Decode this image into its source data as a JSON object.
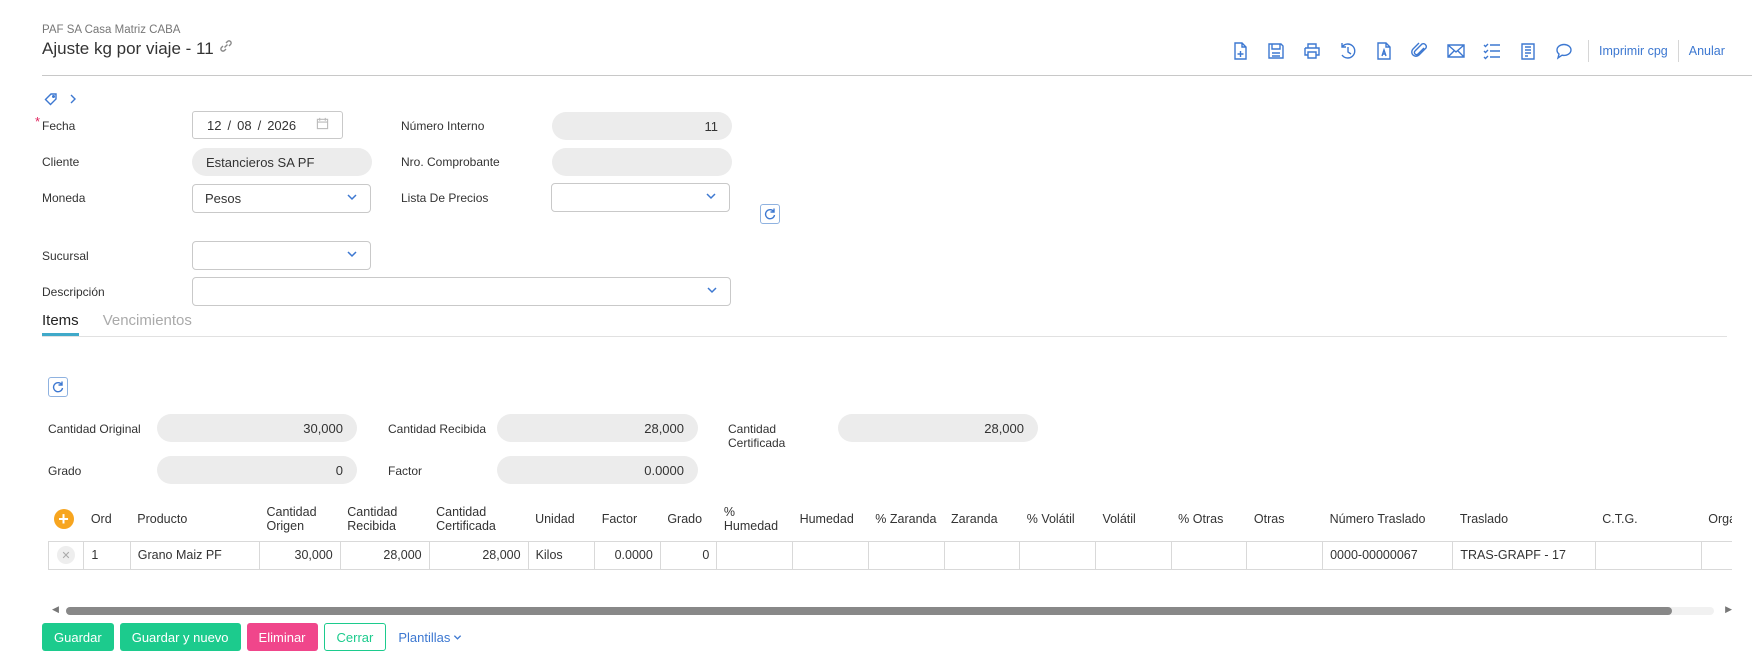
{
  "header": {
    "company": "PAF SA Casa Matriz CABA",
    "title": "Ajuste kg por viaje - 11"
  },
  "toolbar": {
    "icons": [
      "new-doc-icon",
      "save-icon",
      "print-icon",
      "history-icon",
      "pdf-icon",
      "attach-icon",
      "email-icon",
      "checklist-icon",
      "report-icon",
      "comment-icon"
    ],
    "print_cpg": "Imprimir cpg",
    "anular": "Anular"
  },
  "form": {
    "fecha_label": "Fecha",
    "fecha_day": "12",
    "fecha_month": "08",
    "fecha_year": "2026",
    "numero_interno_label": "Número Interno",
    "numero_interno": "11",
    "cliente_label": "Cliente",
    "cliente": "Estancieros SA PF",
    "nro_comprobante_label": "Nro. Comprobante",
    "nro_comprobante": "",
    "moneda_label": "Moneda",
    "moneda": "Pesos",
    "lista_precios_label": "Lista De Precios",
    "lista_precios": "",
    "sucursal_label": "Sucursal",
    "sucursal": "",
    "descripcion_label": "Descripción",
    "descripcion": ""
  },
  "tabs": [
    {
      "label": "Items",
      "active": true
    },
    {
      "label": "Vencimientos",
      "active": false
    }
  ],
  "totals": {
    "cantidad_original_label": "Cantidad Original",
    "cantidad_original": "30,000",
    "cantidad_recibida_label": "Cantidad Recibida",
    "cantidad_recibida": "28,000",
    "cantidad_certificada_label": "Cantidad Certificada",
    "cantidad_certificada": "28,000",
    "grado_label": "Grado",
    "grado": "0",
    "factor_label": "Factor",
    "factor": "0.0000"
  },
  "table": {
    "columns": [
      "Ord",
      "Producto",
      "Cantidad Origen",
      "Cantidad Recibida",
      "Cantidad Certificada",
      "Unidad",
      "Factor",
      "Grado",
      "% Humedad",
      "Humedad",
      "% Zaranda",
      "Zaranda",
      "% Volátil",
      "Volátil",
      "% Otras",
      "Otras",
      "Número Traslado",
      "Traslado",
      "C.T.G.",
      "Organiz"
    ],
    "rows": [
      {
        "ord": "1",
        "producto": "Grano Maiz PF",
        "cant_origen": "30,000",
        "cant_recibida": "28,000",
        "cant_certificada": "28,000",
        "unidad": "Kilos",
        "factor": "0.0000",
        "grado": "0",
        "pct_humedad": "",
        "humedad": "",
        "pct_zaranda": "",
        "zaranda": "",
        "pct_volatil": "",
        "volatil": "",
        "pct_otras": "",
        "otras": "",
        "numero_traslado": "0000-00000067",
        "traslado": "TRAS-GRAPF - 17",
        "ctg": "",
        "organiz": ""
      }
    ]
  },
  "footer": {
    "guardar": "Guardar",
    "guardar_nuevo": "Guardar y nuevo",
    "eliminar": "Eliminar",
    "cerrar": "Cerrar",
    "plantillas": "Plantillas"
  },
  "colors": {
    "accent": "#3d78d1",
    "green": "#1ccb8d",
    "pink": "#f0468b",
    "add": "#f7a51f",
    "required": "#e0245e"
  }
}
